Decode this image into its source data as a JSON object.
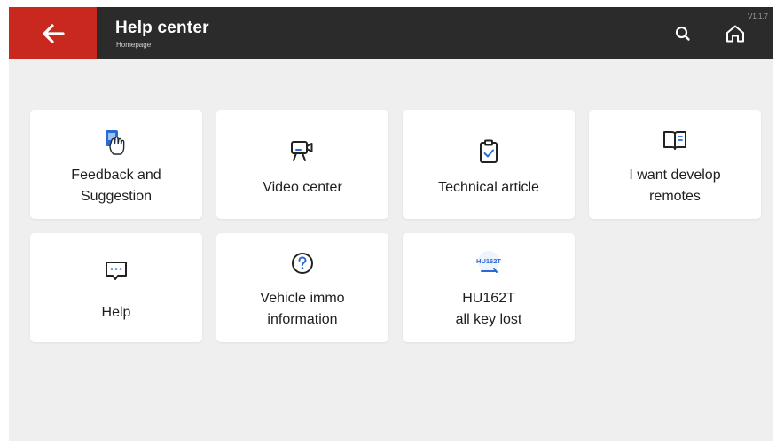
{
  "header": {
    "title": "Help center",
    "subtitle": "Homepage",
    "version": "V1.1.7"
  },
  "colors": {
    "accent_red": "#c8281e",
    "topbar": "#2b2b2b",
    "icon_blue": "#2a6ad8",
    "background": "#efefef"
  },
  "icons": {
    "back": "arrow-left-icon",
    "search": "search-icon",
    "home": "home-icon"
  },
  "cards": [
    {
      "line1": "Feedback and",
      "line2": "Suggestion",
      "icon": "hand-touch-icon"
    },
    {
      "line1": "Video center",
      "icon": "video-camera-icon"
    },
    {
      "line1": "Technical article",
      "icon": "clipboard-check-icon"
    },
    {
      "line1": "I want develop",
      "line2": "remotes",
      "icon": "book-icon"
    },
    {
      "line1": "Help",
      "icon": "chat-bubble-icon"
    },
    {
      "line1": "Vehicle immo",
      "line2": "information",
      "icon": "question-circle-icon"
    },
    {
      "line1": "HU162T",
      "line2": "all key lost",
      "icon": "hu162t-key-icon",
      "badge": "HU162T"
    }
  ]
}
